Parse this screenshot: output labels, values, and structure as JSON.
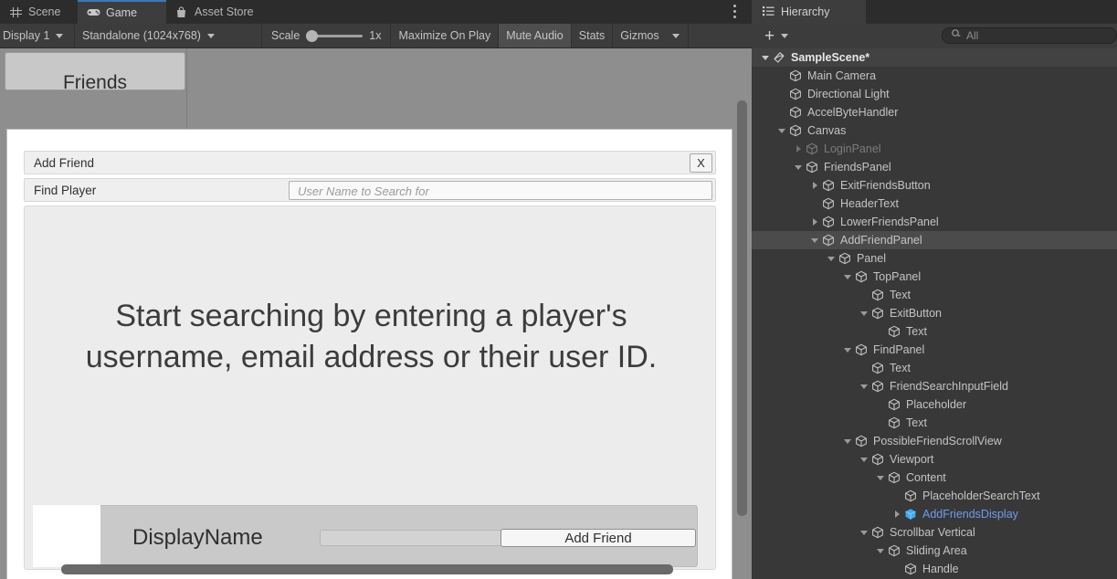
{
  "game_view": {
    "tabs": [
      {
        "label": "Scene",
        "icon": "grid-icon",
        "active": false
      },
      {
        "label": "Game",
        "icon": "gamepad-icon",
        "active": true
      },
      {
        "label": "Asset Store",
        "icon": "shopping-bag-icon",
        "active": false
      }
    ],
    "overflow_menu_icon": "kebab-menu-icon",
    "toolbar": {
      "display_dropdown": "Display 1",
      "resolution_dropdown": "Standalone (1024x768)",
      "scale_label": "Scale",
      "scale_value": "1x",
      "maximize_on_play": "Maximize On Play",
      "mute_audio": "Mute Audio",
      "stats": "Stats",
      "gizmos": "Gizmos"
    },
    "background": {
      "friends_tab_label": "Friends"
    }
  },
  "modal": {
    "title": "Add Friend",
    "exit_label": "X",
    "find_panel": {
      "label": "Find Player",
      "search_placeholder": "User Name to Search for",
      "search_value": ""
    },
    "placeholder_search_text": "Start searching by entering a player's username, email address or their user ID.",
    "friend_entry": {
      "display_name": "DisplayName",
      "add_button_label": "Add Friend"
    }
  },
  "hierarchy": {
    "tab_label": "Hierarchy",
    "tab_icon": "list-tree-icon",
    "create_label": "+",
    "create_icon": "plus-icon",
    "create_caret_icon": "chevron-down-icon",
    "search_icon": "search-icon",
    "search_placeholder": "All",
    "search_value": "All",
    "nodes": [
      {
        "label": "SampleScene*",
        "depth": 0,
        "twisty": "open",
        "style": "scene-root"
      },
      {
        "label": "Main Camera",
        "depth": 1,
        "twisty": "none",
        "style": ""
      },
      {
        "label": "Directional Light",
        "depth": 1,
        "twisty": "none",
        "style": ""
      },
      {
        "label": "AccelByteHandler",
        "depth": 1,
        "twisty": "none",
        "style": ""
      },
      {
        "label": "Canvas",
        "depth": 1,
        "twisty": "open",
        "style": ""
      },
      {
        "label": "LoginPanel",
        "depth": 2,
        "twisty": "closed",
        "style": "dimmed"
      },
      {
        "label": "FriendsPanel",
        "depth": 2,
        "twisty": "open",
        "style": ""
      },
      {
        "label": "ExitFriendsButton",
        "depth": 3,
        "twisty": "closed",
        "style": ""
      },
      {
        "label": "HeaderText",
        "depth": 3,
        "twisty": "none",
        "style": ""
      },
      {
        "label": "LowerFriendsPanel",
        "depth": 3,
        "twisty": "closed",
        "style": ""
      },
      {
        "label": "AddFriendPanel",
        "depth": 3,
        "twisty": "open",
        "style": "selected"
      },
      {
        "label": "Panel",
        "depth": 4,
        "twisty": "open",
        "style": ""
      },
      {
        "label": "TopPanel",
        "depth": 5,
        "twisty": "open",
        "style": ""
      },
      {
        "label": "Text",
        "depth": 6,
        "twisty": "none",
        "style": ""
      },
      {
        "label": "ExitButton",
        "depth": 6,
        "twisty": "open",
        "style": ""
      },
      {
        "label": "Text",
        "depth": 7,
        "twisty": "none",
        "style": ""
      },
      {
        "label": "FindPanel",
        "depth": 5,
        "twisty": "open",
        "style": ""
      },
      {
        "label": "Text",
        "depth": 6,
        "twisty": "none",
        "style": ""
      },
      {
        "label": "FriendSearchInputField",
        "depth": 6,
        "twisty": "open",
        "style": ""
      },
      {
        "label": "Placeholder",
        "depth": 7,
        "twisty": "none",
        "style": ""
      },
      {
        "label": "Text",
        "depth": 7,
        "twisty": "none",
        "style": ""
      },
      {
        "label": "PossibleFriendScrollView",
        "depth": 5,
        "twisty": "open",
        "style": ""
      },
      {
        "label": "Viewport",
        "depth": 6,
        "twisty": "open",
        "style": ""
      },
      {
        "label": "Content",
        "depth": 7,
        "twisty": "open",
        "style": ""
      },
      {
        "label": "PlaceholderSearchText",
        "depth": 8,
        "twisty": "none",
        "style": ""
      },
      {
        "label": "AddFriendsDisplay",
        "depth": 8,
        "twisty": "closed",
        "style": "prefab"
      },
      {
        "label": "Scrollbar Vertical",
        "depth": 6,
        "twisty": "open",
        "style": ""
      },
      {
        "label": "Sliding Area",
        "depth": 7,
        "twisty": "open",
        "style": ""
      },
      {
        "label": "Handle",
        "depth": 8,
        "twisty": "none",
        "style": ""
      }
    ]
  },
  "colors": {
    "accent_blue": "#3a79bb",
    "prefab_blue": "#6f9ceb",
    "panel_dark": "#383838",
    "toolbar_dark": "#3c3c3c",
    "selection_gray": "#4b4b4b",
    "game_bg": "#8e8e8e"
  }
}
